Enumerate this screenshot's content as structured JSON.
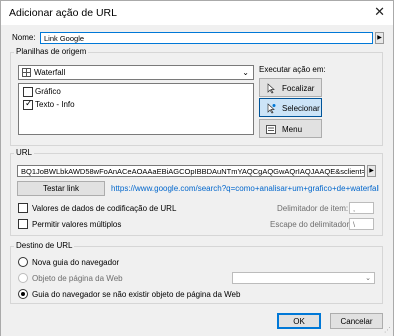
{
  "window": {
    "title": "Adicionar ação de URL",
    "close_glyph": "✕"
  },
  "name_field": {
    "label": "Nome:",
    "value": "Link Google"
  },
  "source_sheets": {
    "group_title": "Planilhas de origem",
    "selected_sheet": "Waterfall",
    "items": [
      {
        "label": "Gráfico",
        "checked": false
      },
      {
        "label": "Texto - Info",
        "checked": true
      }
    ]
  },
  "run_action": {
    "label": "Executar ação em:",
    "buttons": [
      {
        "label": "Focalizar",
        "icon": "focus-icon",
        "selected": false
      },
      {
        "label": "Selecionar",
        "icon": "select-cursor-icon",
        "selected": true
      },
      {
        "label": "Menu",
        "icon": "menu-icon",
        "selected": false
      }
    ]
  },
  "url": {
    "group_title": "URL",
    "value": "BQ1JoBWLbkAWD58wFoAnACeAOAAaEBiAGCOpIBBDAuNTmYAQCgAQGwAQrIAQJAAQE&sclient=gws-wiz",
    "test_button": "Testar link",
    "test_result": "https://www.google.com/search?q=como+analisar+um+grafico+de+waterfall&s",
    "encode_label": "Valores de dados de codificação de URL",
    "multi_label": "Permitir valores múltiplos",
    "item_delim_label": "Delimitador de item:",
    "item_delim_value": ",",
    "escape_delim_label": "Escape do delimitador:",
    "escape_delim_value": "\\"
  },
  "target": {
    "group_title": "Destino de URL",
    "options": [
      {
        "label": "Nova guia do navegador",
        "checked": false,
        "disabled": false
      },
      {
        "label": "Objeto de página da Web",
        "checked": false,
        "disabled": true
      },
      {
        "label": "Guia do navegador se não existir objeto de página da Web",
        "checked": true,
        "disabled": false
      }
    ]
  },
  "footer": {
    "ok_label": "OK",
    "cancel_label": "Cancelar"
  },
  "colors": {
    "accent": "#0078d7",
    "link": "#0066cc",
    "selected_bg": "#cce4f7"
  }
}
